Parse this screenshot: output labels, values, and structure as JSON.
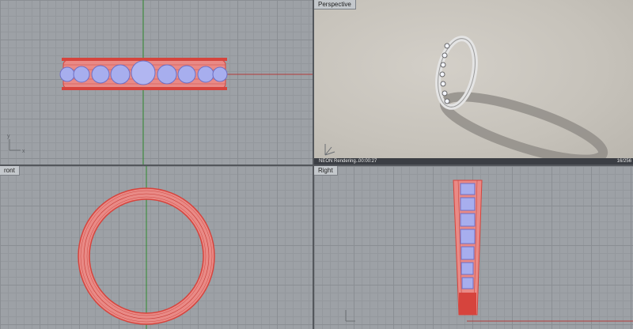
{
  "viewports": {
    "top": {
      "label": ""
    },
    "perspective": {
      "label": "Perspective"
    },
    "front": {
      "label": "ront"
    },
    "right": {
      "label": "Right"
    }
  },
  "render_status": {
    "text": "NEON Rendering...",
    "time": "00:00:27",
    "passes": "16/256"
  },
  "axis_labels": {
    "x": "x",
    "y": "y",
    "z": "z"
  },
  "colors": {
    "grid_bg": "#9da1a6",
    "wire_red": "#d9534f",
    "gem_blue": "#9aa3e8",
    "axis_green": "#2f8a2f",
    "axis_red": "#b33a3a"
  }
}
